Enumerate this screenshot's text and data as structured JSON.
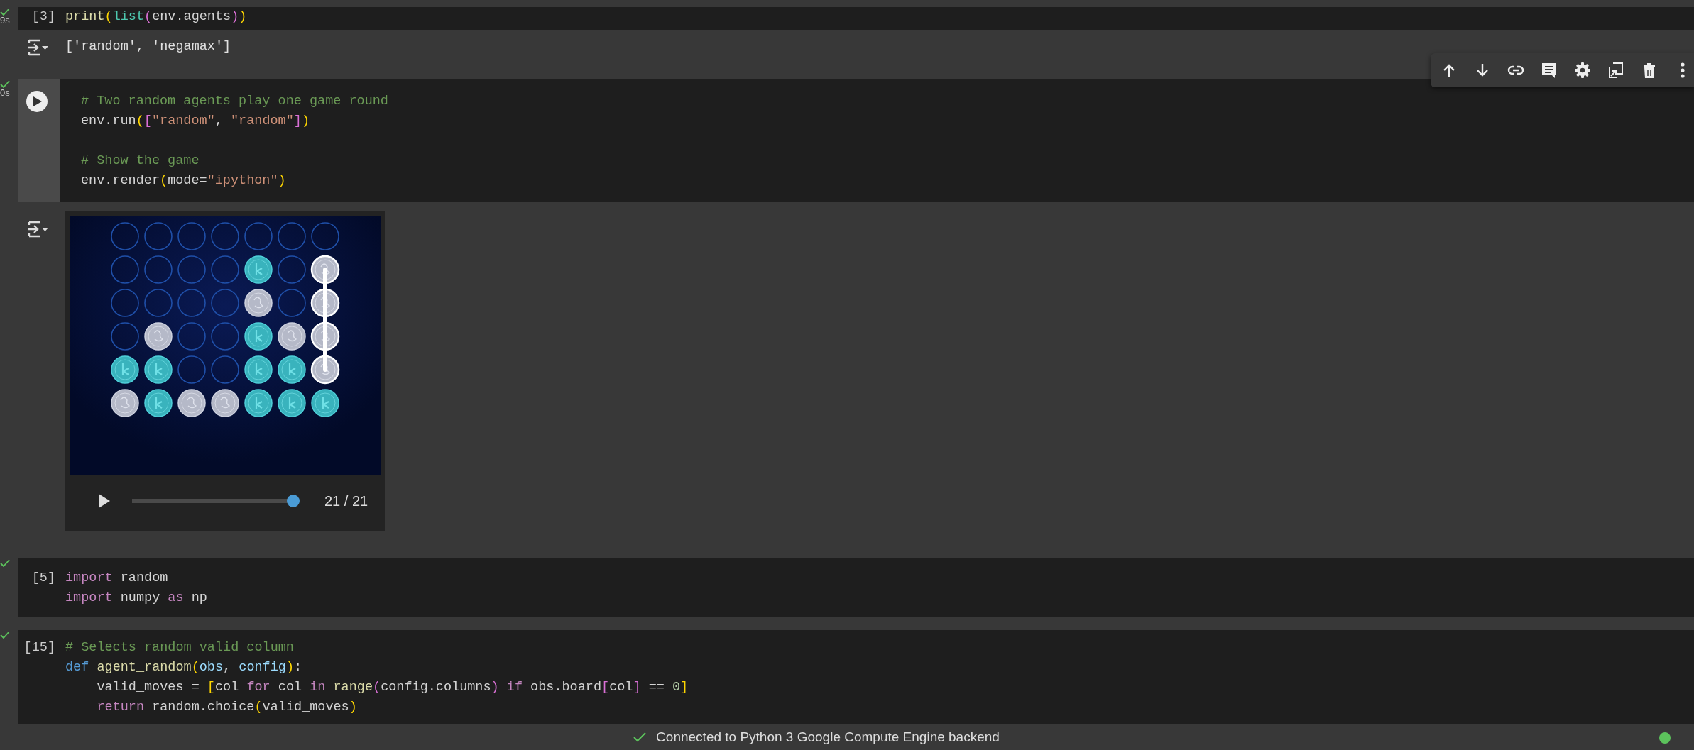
{
  "cell_toolbar": [
    {
      "kind": "up"
    },
    {
      "kind": "down"
    },
    {
      "kind": "link"
    },
    {
      "kind": "comment"
    },
    {
      "kind": "settings"
    },
    {
      "kind": "mirror"
    },
    {
      "kind": "delete"
    },
    {
      "kind": "more"
    }
  ],
  "cells": [
    {
      "focused": false,
      "executed": true,
      "run_time": "9s",
      "execution_count": "[3]",
      "lines": [
        {
          "kind": "code",
          "tokens": [
            {
              "kind": "function",
              "text": "print"
            },
            {
              "kind": "bracket1",
              "text": "("
            },
            {
              "kind": "builtin",
              "text": "list"
            },
            {
              "kind": "bracket2",
              "text": "("
            },
            {
              "kind": "plain",
              "text": "env.agents"
            },
            {
              "kind": "bracket2",
              "text": ")"
            },
            {
              "kind": "bracket1",
              "text": ")"
            }
          ]
        }
      ],
      "output": {
        "kind": "text",
        "text": "['random', 'negamax']"
      }
    },
    {
      "focused": true,
      "executed": true,
      "run_time": "0s",
      "lines": [
        {
          "kind": "code",
          "tokens": [
            {
              "kind": "comment",
              "text": "# Two random agents play one game round"
            }
          ]
        },
        {
          "kind": "code",
          "tokens": [
            {
              "kind": "plain",
              "text": "env.run"
            },
            {
              "kind": "bracket1",
              "text": "("
            },
            {
              "kind": "bracket2",
              "text": "["
            },
            {
              "kind": "string",
              "text": "\"random\""
            },
            {
              "kind": "plain",
              "text": ", "
            },
            {
              "kind": "string",
              "text": "\"random\""
            },
            {
              "kind": "bracket2",
              "text": "]"
            },
            {
              "kind": "bracket1",
              "text": ")"
            }
          ]
        },
        {
          "kind": "blank"
        },
        {
          "kind": "code",
          "tokens": [
            {
              "kind": "comment",
              "text": "# Show the game"
            }
          ]
        },
        {
          "kind": "code",
          "tokens": [
            {
              "kind": "plain",
              "text": "env.render"
            },
            {
              "kind": "bracket1",
              "text": "("
            },
            {
              "kind": "plain",
              "text": "mode="
            },
            {
              "kind": "string",
              "text": "\"ipython\""
            },
            {
              "kind": "bracket1",
              "text": ")"
            }
          ]
        }
      ],
      "output": {
        "kind": "game",
        "board": {
          "rows": [
            {
              "cells": [
                {
                  "kind": "empty",
                  "winning": false
                },
                {
                  "kind": "empty",
                  "winning": false
                },
                {
                  "kind": "empty",
                  "winning": false
                },
                {
                  "kind": "empty",
                  "winning": false
                },
                {
                  "kind": "empty",
                  "winning": false
                },
                {
                  "kind": "empty",
                  "winning": false
                },
                {
                  "kind": "empty",
                  "winning": false
                }
              ]
            },
            {
              "cells": [
                {
                  "kind": "empty",
                  "winning": false
                },
                {
                  "kind": "empty",
                  "winning": false
                },
                {
                  "kind": "empty",
                  "winning": false
                },
                {
                  "kind": "empty",
                  "winning": false
                },
                {
                  "kind": "player1",
                  "winning": false
                },
                {
                  "kind": "empty",
                  "winning": false
                },
                {
                  "kind": "player2",
                  "winning": true
                }
              ]
            },
            {
              "cells": [
                {
                  "kind": "empty",
                  "winning": false
                },
                {
                  "kind": "empty",
                  "winning": false
                },
                {
                  "kind": "empty",
                  "winning": false
                },
                {
                  "kind": "empty",
                  "winning": false
                },
                {
                  "kind": "player2",
                  "winning": false
                },
                {
                  "kind": "empty",
                  "winning": false
                },
                {
                  "kind": "player2",
                  "winning": true
                }
              ]
            },
            {
              "cells": [
                {
                  "kind": "empty",
                  "winning": false
                },
                {
                  "kind": "player2",
                  "winning": false
                },
                {
                  "kind": "empty",
                  "winning": false
                },
                {
                  "kind": "empty",
                  "winning": false
                },
                {
                  "kind": "player1",
                  "winning": false
                },
                {
                  "kind": "player2",
                  "winning": false
                },
                {
                  "kind": "player2",
                  "winning": true
                }
              ]
            },
            {
              "cells": [
                {
                  "kind": "player1",
                  "winning": false
                },
                {
                  "kind": "player1",
                  "winning": false
                },
                {
                  "kind": "empty",
                  "winning": false
                },
                {
                  "kind": "empty",
                  "winning": false
                },
                {
                  "kind": "player1",
                  "winning": false
                },
                {
                  "kind": "player1",
                  "winning": false
                },
                {
                  "kind": "player2",
                  "winning": true
                }
              ]
            },
            {
              "cells": [
                {
                  "kind": "player2",
                  "winning": false
                },
                {
                  "kind": "player1",
                  "winning": false
                },
                {
                  "kind": "player2",
                  "winning": false
                },
                {
                  "kind": "player2",
                  "winning": false
                },
                {
                  "kind": "player1",
                  "winning": false
                },
                {
                  "kind": "player1",
                  "winning": false
                },
                {
                  "kind": "player1",
                  "winning": false
                }
              ]
            }
          ]
        },
        "player": {
          "level": 1.0,
          "frame": "21 / 21"
        }
      }
    },
    {
      "focused": false,
      "executed": true,
      "execution_count": "[5]",
      "lines": [
        {
          "kind": "code",
          "tokens": [
            {
              "kind": "keyword",
              "text": "import"
            },
            {
              "kind": "plain",
              "text": " random"
            }
          ]
        },
        {
          "kind": "code",
          "tokens": [
            {
              "kind": "keyword",
              "text": "import"
            },
            {
              "kind": "plain",
              "text": " numpy "
            },
            {
              "kind": "keyword",
              "text": "as"
            },
            {
              "kind": "plain",
              "text": " np"
            }
          ]
        }
      ]
    },
    {
      "focused": false,
      "executed": true,
      "execution_count": "[15]",
      "lines": [
        {
          "kind": "code",
          "tokens": [
            {
              "kind": "comment",
              "text": "# Selects random valid column"
            }
          ]
        },
        {
          "kind": "code",
          "tokens": [
            {
              "kind": "def",
              "text": "def "
            },
            {
              "kind": "function",
              "text": "agent_random"
            },
            {
              "kind": "bracket1",
              "text": "("
            },
            {
              "kind": "param",
              "text": "obs"
            },
            {
              "kind": "plain",
              "text": ", "
            },
            {
              "kind": "param",
              "text": "config"
            },
            {
              "kind": "bracket1",
              "text": ")"
            },
            {
              "kind": "plain",
              "text": ":"
            }
          ]
        },
        {
          "kind": "code",
          "tokens": [
            {
              "kind": "plain",
              "text": "    valid_moves = "
            },
            {
              "kind": "bracket1",
              "text": "["
            },
            {
              "kind": "plain",
              "text": "col "
            },
            {
              "kind": "keyword",
              "text": "for"
            },
            {
              "kind": "plain",
              "text": " col "
            },
            {
              "kind": "keyword",
              "text": "in "
            },
            {
              "kind": "function",
              "text": "range"
            },
            {
              "kind": "bracket2",
              "text": "("
            },
            {
              "kind": "plain",
              "text": "config.columns"
            },
            {
              "kind": "bracket2",
              "text": ")"
            },
            {
              "kind": "keyword",
              "text": " if"
            },
            {
              "kind": "plain",
              "text": " obs.board"
            },
            {
              "kind": "bracket2",
              "text": "["
            },
            {
              "kind": "plain",
              "text": "col"
            },
            {
              "kind": "bracket2",
              "text": "]"
            },
            {
              "kind": "plain",
              "text": " == "
            },
            {
              "kind": "number",
              "text": "0"
            },
            {
              "kind": "bracket1",
              "text": "]"
            }
          ]
        },
        {
          "kind": "code",
          "tokens": [
            {
              "kind": "keyword",
              "text": "    return"
            },
            {
              "kind": "plain",
              "text": " random.choice"
            },
            {
              "kind": "bracket1",
              "text": "("
            },
            {
              "kind": "plain",
              "text": "valid_moves"
            },
            {
              "kind": "bracket1",
              "text": ")"
            }
          ]
        }
      ]
    }
  ],
  "status_bar": {
    "connected": true,
    "text": "Connected to Python 3 Google Compute Engine backend"
  }
}
